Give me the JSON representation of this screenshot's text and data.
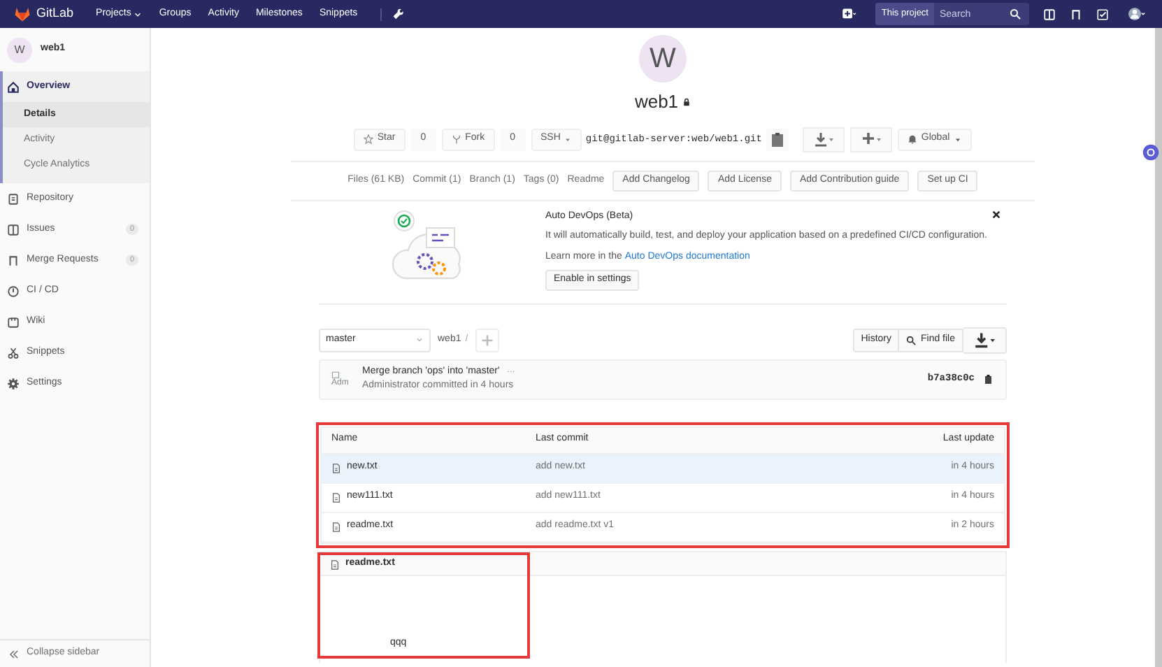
{
  "navbar": {
    "logo": "GitLab",
    "links": [
      {
        "label": "Projects",
        "dropdown": true
      },
      {
        "label": "Groups",
        "dropdown": false
      },
      {
        "label": "Activity",
        "dropdown": false
      },
      {
        "label": "Milestones",
        "dropdown": false
      },
      {
        "label": "Snippets",
        "dropdown": false
      }
    ],
    "scope": "This project",
    "search": {
      "placeholder": "Search"
    }
  },
  "sidebar": {
    "project": {
      "letter": "W",
      "name": "web1"
    },
    "items": [
      {
        "label": "Overview",
        "kind": "home",
        "expanded": true,
        "children": [
          {
            "label": "Details",
            "selected": true
          },
          {
            "label": "Activity",
            "selected": false
          },
          {
            "label": "Cycle Analytics",
            "selected": false
          }
        ]
      },
      {
        "label": "Repository",
        "kind": "repo",
        "expanded": false
      },
      {
        "label": "Issues",
        "kind": "issues",
        "count": "0",
        "expanded": false
      },
      {
        "label": "Merge Requests",
        "kind": "merge",
        "count": "0",
        "expanded": false
      },
      {
        "label": "CI / CD",
        "kind": "ci",
        "expanded": false
      },
      {
        "label": "Wiki",
        "kind": "wiki",
        "expanded": false
      },
      {
        "label": "Snippets",
        "kind": "snippets",
        "expanded": false
      },
      {
        "label": "Settings",
        "kind": "settings",
        "expanded": false
      }
    ],
    "collapse": "Collapse sidebar"
  },
  "project": {
    "letter": "W",
    "name": "web1",
    "private": true,
    "star": {
      "label": "Star",
      "count": "0"
    },
    "fork": {
      "label": "Fork",
      "count": "0"
    },
    "protocol": "SSH",
    "clone_url": "git@gitlab-server:web/web1.git",
    "notification": "Global"
  },
  "stats": [
    {
      "label": "Files (61 KB)",
      "kind": "link"
    },
    {
      "label": "Commit (1)",
      "kind": "link"
    },
    {
      "label": "Branch (1)",
      "kind": "link"
    },
    {
      "label": "Tags (0)",
      "kind": "link"
    },
    {
      "label": "Readme",
      "kind": "link"
    },
    {
      "label": "Add Changelog",
      "kind": "button"
    },
    {
      "label": "Add License",
      "kind": "button"
    },
    {
      "label": "Add Contribution guide",
      "kind": "button"
    },
    {
      "label": "Set up CI",
      "kind": "button"
    }
  ],
  "auto_devops": {
    "title": "Auto DevOps (Beta)",
    "text": "It will automatically build, test, and deploy your application based on a predefined CI/CD configuration.",
    "learn_prefix": "Learn more in the",
    "learn_link": "Auto DevOps documentation",
    "button": "Enable in settings"
  },
  "tree_bar": {
    "branch": "master",
    "path": "web1",
    "separator": "/",
    "history": "History",
    "find": "Find file"
  },
  "last_commit": {
    "avatar_alt": "Adm",
    "message": "Merge branch 'ops' into 'master'",
    "ellipsis": "…",
    "byline": "Administrator committed in 4 hours",
    "sha": "b7a38c0c"
  },
  "table": {
    "columns": [
      "Name",
      "Last commit",
      "Last update"
    ],
    "rows": [
      {
        "name": "new.txt",
        "commit": "add new.txt",
        "updated": "in 4 hours",
        "selected": true
      },
      {
        "name": "new111.txt",
        "commit": "add new111.txt",
        "updated": "in 4 hours",
        "selected": false
      },
      {
        "name": "readme.txt",
        "commit": "add readme.txt v1",
        "updated": "in 2 hours",
        "selected": false
      }
    ]
  },
  "readme": {
    "file": "readme.txt",
    "content": "qqq"
  }
}
